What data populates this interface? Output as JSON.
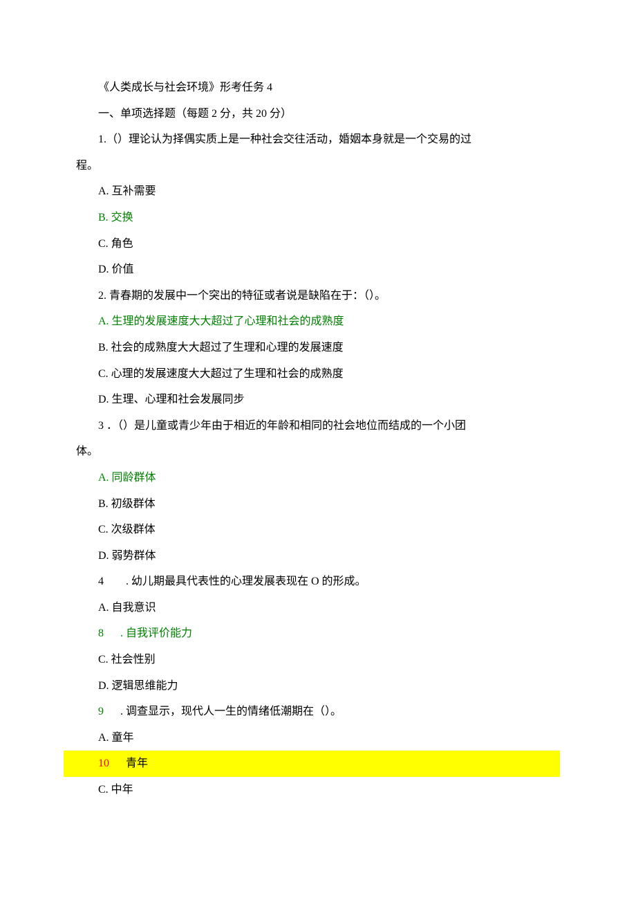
{
  "title": "《人类成长与社会环境》形考任务 4",
  "section1_header": "一、单项选择题（每题 2 分，共 20 分）",
  "q1": {
    "stem": "1.（）理论认为择偶实质上是一种社会交往活动，婚姻本身就是一个交易的过",
    "stem_cont": "程。",
    "a": "A. 互补需要",
    "b": "B. 交换",
    "c": "C. 角色",
    "d": "D. 价值"
  },
  "q2": {
    "stem": "2. 青春期的发展中一个突出的特征或者说是缺陷在于：（）。",
    "a": "A. 生理的发展速度大大超过了心理和社会的成熟度",
    "b": "B. 社会的成熟度大大超过了生理和心理的发展速度",
    "c": "C. 心理的发展速度大大超过了生理和社会的成熟度",
    "d": "D. 生理、心理和社会发展同步"
  },
  "q3": {
    "stem": "3 ．（）是儿童或青少年由于相近的年龄和相同的社会地位而结成的一个小团",
    "stem_cont": "体。",
    "a": "A. 同龄群体",
    "b": "B. 初级群体",
    "c": "C. 次级群体",
    "d": "D. 弱势群体"
  },
  "q4": {
    "stem": "4　　. 幼儿期最具代表性的心理发展表现在 O 的形成。",
    "a": "A. 自我意识",
    "b_num": "8",
    "b_text": ". 自我评价能力",
    "c": "C. 社会性别",
    "d": "D. 逻辑思维能力"
  },
  "q5": {
    "stem_num": "9",
    "stem_text": ". 调查显示，现代人一生的情绪低潮期在（）。",
    "a": "A. 童年",
    "b_num": "10",
    "b_text": "青年",
    "c": "C. 中年"
  }
}
